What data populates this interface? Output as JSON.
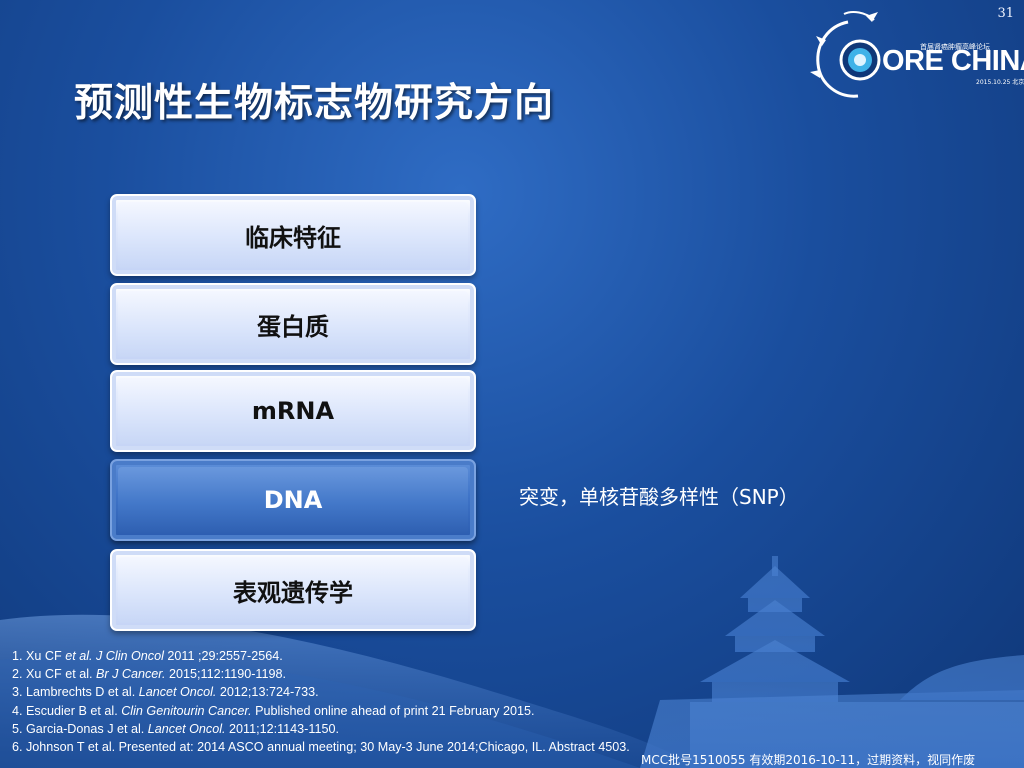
{
  "slide_number": "31",
  "logo": {
    "top_text": "首届肾癌肿瘤高峰论坛",
    "main_text": "ORE CHINA",
    "date_text": "2015.10.25 北京"
  },
  "title": "预测性生物标志物研究方向",
  "cards": [
    {
      "label": "临床特征",
      "active": false
    },
    {
      "label": "蛋白质",
      "active": false
    },
    {
      "label": "mRNA",
      "active": false
    },
    {
      "label": "DNA",
      "active": true
    },
    {
      "label": "表观遗传学",
      "active": false
    }
  ],
  "dna_note": "突变，单核苷酸多样性（SNP）",
  "references": [
    {
      "pre": "1. Xu CF ",
      "italic": "et al. J Clin Oncol",
      "post": " 2011 ;29:2557-2564."
    },
    {
      "pre": "2. Xu CF et al. ",
      "italic": "Br J Cancer.",
      "post": " 2015;112:1190-1198."
    },
    {
      "pre": "3. Lambrechts D et al. ",
      "italic": "Lancet Oncol.",
      "post": " 2012;13:724-733."
    },
    {
      "pre": "4. Escudier B et al. ",
      "italic": "Clin Genitourin Cancer.",
      "post": " Published online ahead of print 21 February 2015."
    },
    {
      "pre": "5. Garcia-Donas J et al. ",
      "italic": "Lancet Oncol.",
      "post": " 2011;12:1143-1150."
    },
    {
      "pre": "6. Johnson T et al. Presented at: 2014 ASCO annual meeting; 30 May-3 June 2014;Chicago, IL. Abstract 4503.",
      "italic": "",
      "post": ""
    }
  ],
  "footer": "MCC批号1510055 有效期2016-10-11，过期资料，视同作废",
  "colors": {
    "background": "#1a4e9e",
    "card": "#d9e4fb",
    "card_active": "#3f74c8",
    "text": "#ffffff"
  }
}
